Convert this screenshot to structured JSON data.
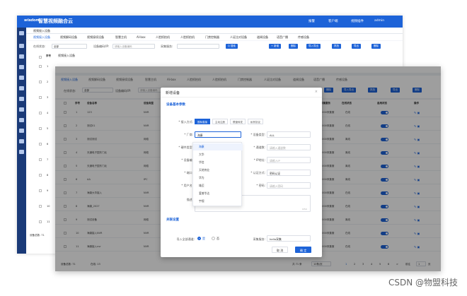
{
  "back": {
    "logo": "wisdom",
    "title": "智慧视频融合云",
    "topright": {
      "alarm": "报警",
      "client": "客户端",
      "video": "视频插件",
      "user": "admin"
    },
    "crumb": "视频接入设备",
    "tabs": [
      "视频接入设备",
      "视频解码设备",
      "视频接续设备",
      "智慧主机",
      "AI-box",
      "人脸抓拍机",
      "人脸抓拍机",
      "门禁控制器",
      "人证比对设备",
      "道闸设备",
      "语音广播",
      "传感设备"
    ],
    "filters": {
      "online_label": "在线状态:",
      "online_value": "全部",
      "code_label": "设备编码/IP:",
      "code_placeholder": "请输入设备编码",
      "vendor_label": "采集服务:",
      "search": "Q 搜索"
    },
    "buttons": [
      "+ 新增",
      "删除",
      "导入导出",
      "抓拍",
      "导出",
      "删除"
    ],
    "crumb2": "视频接入设备",
    "row_nums": [
      "1",
      "2",
      "3",
      "4",
      "5",
      "6",
      "7",
      "8",
      "9",
      "10",
      "11"
    ],
    "footer": "设备总数: 71"
  },
  "front": {
    "tabs": [
      "视频接入设备",
      "视频解码设备",
      "视频接续设备",
      "智慧主机",
      "AI-box",
      "人脸抓拍机",
      "人脸抓拍机",
      "门禁控制器",
      "人证比对设备",
      "道闸设备",
      "语音广播",
      "传感设备"
    ],
    "filters": {
      "online_label": "在线状态:",
      "online_value": "全部",
      "code_label": "设备编码/IP:",
      "code_placeholder": "请输入设备编码"
    },
    "right_buttons": [
      "删除",
      "导入导出",
      "抓拍",
      "导出",
      "删除"
    ],
    "headers": [
      "序号",
      "设备名称",
      "设备类型",
      "采集服务",
      "在线状态",
      "启用状态",
      "操作"
    ],
    "rows": [
      {
        "no": "1",
        "name": "123",
        "type": "NVR",
        "svc": "2000采集服",
        "status": "在线"
      },
      {
        "no": "2",
        "name": "测试01",
        "type": "NVR",
        "svc": "2000采集服",
        "status": "在线"
      },
      {
        "no": "3",
        "name": "测试测试",
        "type": "网络",
        "svc": "2000采集服",
        "status": "离线"
      },
      {
        "no": "4",
        "name": "天通电子园东门北",
        "type": "网络",
        "svc": "2000采集服",
        "status": "离线"
      },
      {
        "no": "5",
        "name": "天通电子园东门北",
        "type": "网络",
        "svc": "2000采集服",
        "status": "离线"
      },
      {
        "no": "6",
        "name": "AA",
        "type": "IPC",
        "svc": "2000采集服",
        "status": "离线"
      },
      {
        "no": "7",
        "name": "海康大华接入",
        "type": "NVR",
        "svc": "2000采集服",
        "status": "在线"
      },
      {
        "no": "8",
        "name": "海康_2027",
        "type": "NVR",
        "svc": "2000采集服",
        "status": "在线"
      },
      {
        "no": "9",
        "name": "测试设备",
        "type": "网络",
        "svc": "2000采集服",
        "status": "离线"
      },
      {
        "no": "10",
        "name": "海康接入NVR",
        "type": "NVR",
        "svc": "2000采集服",
        "status": "在线"
      },
      {
        "no": "11",
        "name": "海康接入nvr",
        "type": "NVR",
        "svc": "2000采集服",
        "status": "在线"
      }
    ],
    "footer": {
      "total": "设备总数: 71",
      "online": "在线: 13",
      "count": "共 71 条",
      "per_page": "10条/页",
      "pages": [
        "1",
        "2",
        "3",
        "4",
        "5",
        "6"
      ],
      "next": ">",
      "goto": "前往",
      "page": "1",
      "unit": "页"
    }
  },
  "modal": {
    "title": "新增设备",
    "section_basic": "设备基本参数",
    "access_label": "* 接入方式:",
    "access_options": [
      "国标直接",
      "主动注册",
      "联营转发",
      "私有协议"
    ],
    "vendor_label": "* 厂商:",
    "vendor_value": "海康",
    "devtype_label": "* 设备类型:",
    "devtype_value": "ALL",
    "hard_label": "* 硬件类型:",
    "channel_label": "* 通道数:",
    "channel_placeholder": "请输入通道数",
    "code_label": "* 设备编:",
    "ip_label": "* IP地址:",
    "ip_placeholder": "请输入IP",
    "port_label": "* 端口:",
    "auth_label": "* 认证方式:",
    "auth_value": "密码认证",
    "user_label": "* 用户名:",
    "pwd_label": "* 密码:",
    "pwd_placeholder": "请输入密码",
    "desc_label": "描述:",
    "desc_count": "0/50",
    "vendor_options": [
      "海康",
      "大华",
      "华信",
      "天地伟业",
      "华为",
      "雄迈",
      "爱普华达",
      "宇视"
    ],
    "section_link": "关联设置",
    "import_label": "导入全部通道:",
    "yes": "是",
    "no": "否",
    "collect_label": "采集服务:",
    "collect_value": "hello采集",
    "cancel": "取 消",
    "confirm": "确 定",
    "close": "×"
  },
  "watermark": "CSDN @物盟科技"
}
